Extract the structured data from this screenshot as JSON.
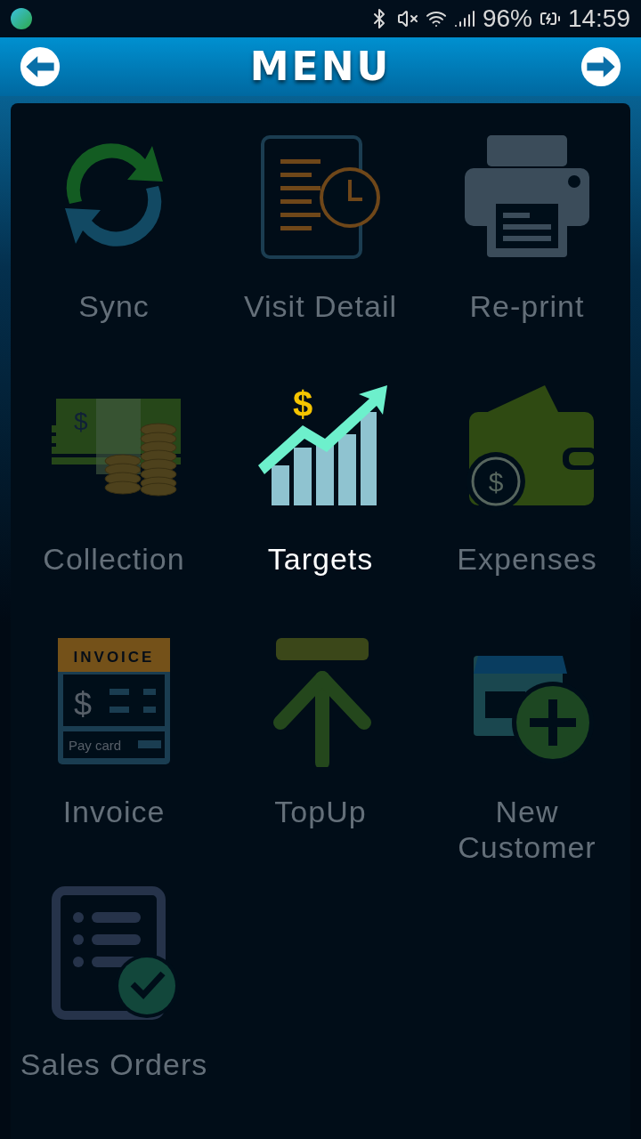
{
  "status_bar": {
    "battery": "96%",
    "time": "14:59"
  },
  "header": {
    "title": "MENU"
  },
  "menu_items": [
    {
      "label": "Sync",
      "selected": false
    },
    {
      "label": "Visit Detail",
      "selected": false
    },
    {
      "label": "Re-print",
      "selected": false
    },
    {
      "label": "Collection",
      "selected": false,
      "icon_texts": [
        "$"
      ]
    },
    {
      "label": "Targets",
      "selected": true,
      "icon_texts": [
        "$"
      ]
    },
    {
      "label": "Expenses",
      "selected": false,
      "icon_texts": [
        "$"
      ]
    },
    {
      "label": "Invoice",
      "selected": false,
      "icon_texts": [
        "INVOICE",
        "$",
        "Pay card"
      ]
    },
    {
      "label": "TopUp",
      "selected": false
    },
    {
      "label": "New\nCustomer",
      "selected": false
    },
    {
      "label": "Sales Orders",
      "selected": false
    }
  ]
}
